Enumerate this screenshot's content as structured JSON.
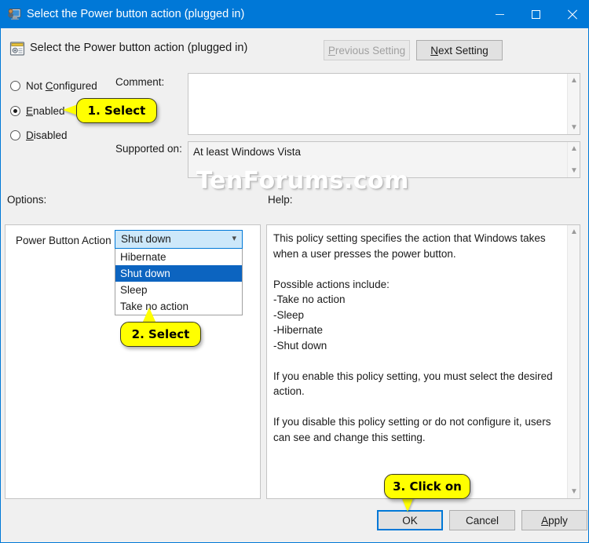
{
  "window": {
    "title": "Select the Power button action (plugged in)",
    "icon": "policy-setting-icon",
    "accent_color": "#0078d7",
    "controls": {
      "minimize": "minimize-icon",
      "maximize": "maximize-icon",
      "close": "close-icon"
    }
  },
  "header": {
    "icon": "policy-setting-icon",
    "title": "Select the Power button action (plugged in)",
    "previous_setting": "Previous Setting",
    "previous_setting_prefix": "P",
    "previous_setting_rest": "revious Setting",
    "previous_setting_enabled": false,
    "next_setting_prefix": "N",
    "next_setting_rest": "ext Setting"
  },
  "state": {
    "options": [
      {
        "label_prefix": "Not ",
        "label_accel": "C",
        "label_rest": "onfigured",
        "selected": false
      },
      {
        "label_prefix": "",
        "label_accel": "E",
        "label_rest": "nabled",
        "selected": true
      },
      {
        "label_prefix": "",
        "label_accel": "D",
        "label_rest": "isabled",
        "selected": false
      }
    ],
    "selected": "Enabled"
  },
  "comment": {
    "label": "Comment:",
    "value": ""
  },
  "supported": {
    "label": "Supported on:",
    "value": "At least Windows Vista"
  },
  "options_panel": {
    "label": "Options:",
    "setting_label": "Power Button Action",
    "combo": {
      "value": "Shut down",
      "arrow": "chevron-down-icon",
      "expanded": true,
      "options": [
        {
          "label": "Hibernate",
          "selected": false
        },
        {
          "label": "Shut down",
          "selected": true
        },
        {
          "label": "Sleep",
          "selected": false
        },
        {
          "label": "Take no action",
          "selected": false
        }
      ],
      "highlight_color": "#0c64c0"
    }
  },
  "help_panel": {
    "label": "Help:",
    "text": "This policy setting specifies the action that Windows takes when a user presses the power button.\n\nPossible actions include:\n-Take no action\n-Sleep\n-Hibernate\n-Shut down\n\nIf you enable this policy setting, you must select the desired action.\n\nIf you disable this policy setting or do not configure it, users can see and change this setting."
  },
  "footer": {
    "ok": "OK",
    "cancel": "Cancel",
    "apply_accel": "A",
    "apply_rest": "pply",
    "focused_button": "OK"
  },
  "callouts": [
    {
      "text": "1. Select",
      "points_to": "enabled-radio",
      "direction": "left"
    },
    {
      "text": "2. Select",
      "points_to": "combo-option-shut-down",
      "direction": "up"
    },
    {
      "text": "3. Click on",
      "points_to": "ok-button",
      "direction": "down"
    }
  ],
  "watermark": {
    "text": "TenForums.com"
  }
}
